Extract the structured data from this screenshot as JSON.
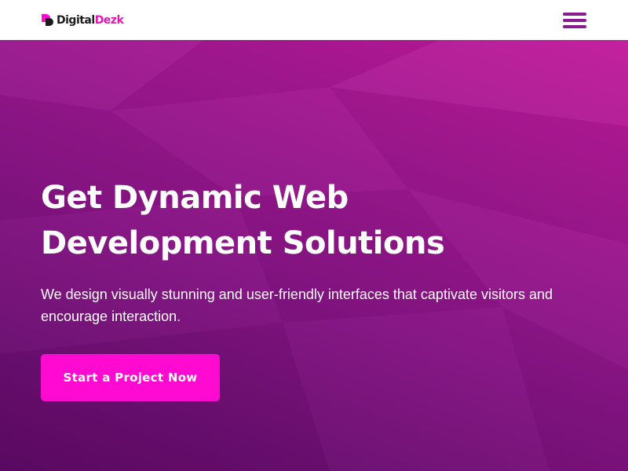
{
  "brand": {
    "name_part1": "Digital",
    "name_part2": "Dezk",
    "logo_icon": "logo-mark-icon",
    "accent_color": "#e316b8"
  },
  "header": {
    "menu_icon": "hamburger-menu-icon",
    "menu_color": "#8a1a8f"
  },
  "hero": {
    "title_line1": "Get Dynamic Web",
    "title_line2": "Development Solutions",
    "subtitle": "We design visually stunning and user-friendly interfaces that captivate visitors and encourage interaction.",
    "cta_label": "Start a Project Now",
    "cta_color": "#ff0ad0",
    "background_colors": [
      "#c2189a",
      "#861484",
      "#5d0a65"
    ]
  }
}
